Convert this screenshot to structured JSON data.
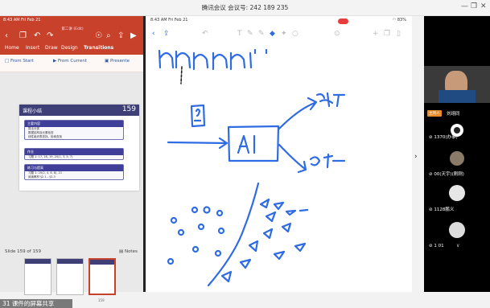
{
  "window": {
    "meeting_title": "腾讯会议 会议号: 242 189 235",
    "minimize": "—",
    "restore": "❐",
    "close": "✕"
  },
  "ppt": {
    "status_time": "8:43 AM  Fri Feb 21",
    "doc_title": "第二讲 (Edit)",
    "tabs": [
      "Home",
      "Insert",
      "Draw",
      "Design",
      "Transitions"
    ],
    "ribbon": {
      "from_start": "From Start",
      "from_current": "From Current",
      "presenter": "Presente"
    },
    "slide": {
      "title": "课程小结",
      "number": "159",
      "boxes": [
        {
          "head": "主要内容",
          "lines": [
            "算法分类",
            "数据结构及元素检查",
            "线性组织表查找、检索查找"
          ]
        },
        {
          "head": "作业",
          "lines": [
            "习题 1: 17, 18, 19, 20(1, 3, 5, 7)"
          ]
        },
        {
          "head": "练习与提高",
          "lines": [
            "习题 1: 20(2, 4, 6, 8), 21",
            "阅读教材 §2.1 – §2.3"
          ]
        }
      ]
    },
    "slide_count": "Slide 159 of 159",
    "notes_label": "Notes",
    "thumb_number": "159",
    "share_banner": "31 课件的屏幕共享"
  },
  "notes_app": {
    "status": "8:43 AM  Fri Feb 21",
    "battery": "83%",
    "handwriting": [
      "AI",
      "猫",
      "狗"
    ]
  },
  "participants": [
    {
      "name": "刘翊同",
      "host_label": "主持人"
    },
    {
      "name": "1370(办事)"
    },
    {
      "name": "00(天宇)(刚刚)"
    },
    {
      "name": "1128鹏义"
    },
    {
      "name": "1 01"
    }
  ],
  "colors": {
    "ppt_red": "#c8412a",
    "ink_blue": "#2f6ce4",
    "host_orange": "#e98a2b"
  }
}
